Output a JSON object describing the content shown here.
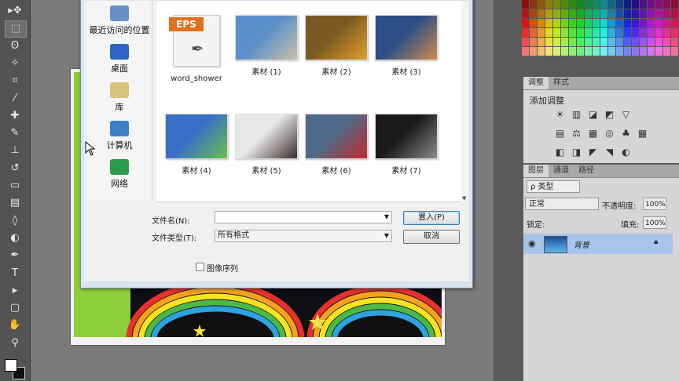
{
  "toolbar": {
    "tools": [
      {
        "name": "move-tool",
        "glyph": "▸✥"
      },
      {
        "name": "marquee-tool",
        "glyph": "⬚"
      },
      {
        "name": "lasso-tool",
        "glyph": "ʘ"
      },
      {
        "name": "magic-wand-tool",
        "glyph": "✧"
      },
      {
        "name": "crop-tool",
        "glyph": "⌗"
      },
      {
        "name": "eyedropper-tool",
        "glyph": "⁄"
      },
      {
        "name": "healing-tool",
        "glyph": "✚"
      },
      {
        "name": "brush-tool",
        "glyph": "✎"
      },
      {
        "name": "stamp-tool",
        "glyph": "⊥"
      },
      {
        "name": "history-brush-tool",
        "glyph": "↺"
      },
      {
        "name": "eraser-tool",
        "glyph": "▭"
      },
      {
        "name": "gradient-tool",
        "glyph": "▤"
      },
      {
        "name": "blur-tool",
        "glyph": "◊"
      },
      {
        "name": "dodge-tool",
        "glyph": "◐"
      },
      {
        "name": "pen-tool",
        "glyph": "✒"
      },
      {
        "name": "type-tool",
        "glyph": "T"
      },
      {
        "name": "path-select-tool",
        "glyph": "▸"
      },
      {
        "name": "shape-tool",
        "glyph": "▢"
      },
      {
        "name": "hand-tool",
        "glyph": "✋"
      },
      {
        "name": "zoom-tool",
        "glyph": "⚲"
      }
    ]
  },
  "dialog": {
    "places": [
      {
        "label": "最近访问的位置",
        "icon": "recent-places-icon"
      },
      {
        "label": "桌面",
        "icon": "desktop-icon"
      },
      {
        "label": "库",
        "icon": "library-icon"
      },
      {
        "label": "计算机",
        "icon": "computer-icon"
      },
      {
        "label": "网络",
        "icon": "network-icon"
      }
    ],
    "files": [
      {
        "label": "word_shower",
        "type": "eps",
        "badge": "EPS"
      },
      {
        "label": "素材 (1)",
        "type": "image",
        "c1": "#5a8fc9",
        "c2": "#c9c1a8"
      },
      {
        "label": "素材 (2)",
        "type": "image",
        "c1": "#7a5a22",
        "c2": "#e3a12a"
      },
      {
        "label": "素材 (3)",
        "type": "image",
        "c1": "#2d4f86",
        "c2": "#d08a4e"
      },
      {
        "label": "素材 (4)",
        "type": "image",
        "c1": "#3a6fc8",
        "c2": "#6ac04a"
      },
      {
        "label": "素材 (5)",
        "type": "image",
        "c1": "#e8e8e8",
        "c2": "#3a2a2a"
      },
      {
        "label": "素材 (6)",
        "type": "image",
        "c1": "#4e6a8a",
        "c2": "#c22a2a"
      },
      {
        "label": "素材 (7)",
        "type": "image",
        "c1": "#1a1a1a",
        "c2": "#8a8a8a"
      }
    ],
    "filename_label": "文件名(N):",
    "filename_value": "",
    "filetype_label": "文件类型(T):",
    "filetype_value": "所有格式",
    "place_button": "置入(P)",
    "cancel_button": "取消",
    "image_sequence_label": "图像序列"
  },
  "adjust_panel": {
    "tabs": [
      "调整",
      "样式"
    ],
    "title": "添加调整"
  },
  "layers_panel": {
    "tabs": [
      "图层",
      "通道",
      "路径"
    ],
    "filter_kind": "ρ 类型",
    "blend_mode": "正常",
    "opacity_label": "不透明度:",
    "opacity_value": "100%",
    "lock_label": "锁定:",
    "fill_label": "填充:",
    "fill_value": "100%",
    "layers": [
      {
        "name": "背景"
      }
    ]
  }
}
